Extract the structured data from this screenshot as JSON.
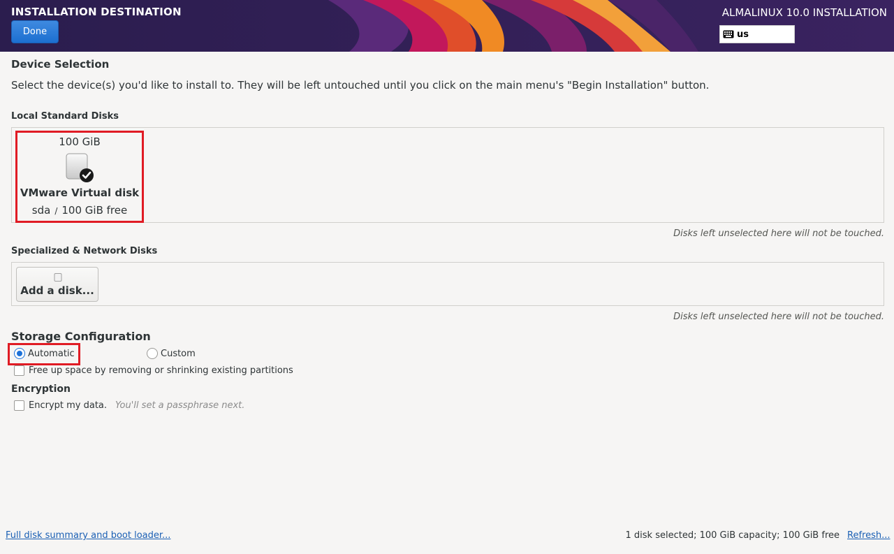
{
  "header": {
    "spoke_title": "INSTALLATION DESTINATION",
    "done_label": "Done",
    "product_title": "ALMALINUX 10.0 INSTALLATION",
    "keyboard_layout": "us",
    "keyboard_icon": "keyboard-icon"
  },
  "device_selection": {
    "title": "Device Selection",
    "instructions": "Select the device(s) you'd like to install to.  They will be left untouched until you click on the main menu's \"Begin Installation\" button."
  },
  "local_disks": {
    "title": "Local Standard Disks",
    "disks": [
      {
        "size": "100 GiB",
        "name": "VMware Virtual disk",
        "device": "sda",
        "separator": "/",
        "free": "100 GiB free",
        "selected": true,
        "icon": "hard-disk-checked-icon"
      }
    ],
    "note": "Disks left unselected here will not be touched."
  },
  "specialized_disks": {
    "title": "Specialized & Network Disks",
    "add_disk_label": "Add a disk...",
    "note": "Disks left unselected here will not be touched."
  },
  "storage_configuration": {
    "title": "Storage Configuration",
    "options": [
      {
        "label": "Automatic",
        "selected": true
      },
      {
        "label": "Custom",
        "selected": false
      }
    ],
    "free_space_label": "Free up space by removing or shrinking existing partitions",
    "free_space_checked": false
  },
  "encryption": {
    "title": "Encryption",
    "encrypt_label": "Encrypt my data.",
    "encrypt_hint": "You'll set a passphrase next.",
    "encrypt_checked": false
  },
  "footer": {
    "summary_link": "Full disk summary and boot loader...",
    "status": "1 disk selected; 100 GiB capacity; 100 GiB free",
    "refresh_link": "Refresh..."
  },
  "colors": {
    "header_bg": "#2b1d4e",
    "accent_blue": "#1c71d8",
    "highlight_red": "#e01b24",
    "background": "#f6f5f4"
  }
}
